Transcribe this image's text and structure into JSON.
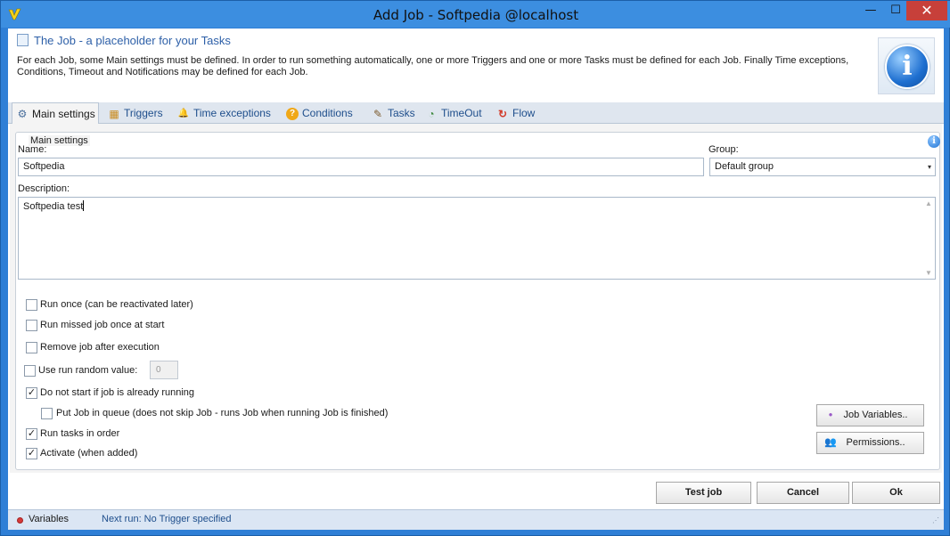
{
  "window": {
    "title": "Add Job - Softpedia @localhost",
    "minimize_glyph": "—",
    "maximize_glyph": "☐",
    "close_glyph": "✕",
    "app_icon": "vision-v-logo-icon"
  },
  "header": {
    "title": "The Job - a placeholder for your Tasks",
    "text": "For each Job, some Main settings must be defined. In order to run something automatically, one or more Triggers and one or more Tasks must be defined for each Job. Finally Time exceptions, Conditions, Timeout and Notifications may be defined for each Job.",
    "info_glyph": "i"
  },
  "tabs": [
    {
      "label": "Main settings",
      "icon": "gears-icon",
      "glyph": "⚙",
      "active": true
    },
    {
      "label": "Triggers",
      "icon": "calendar-icon",
      "glyph": "▦",
      "active": false
    },
    {
      "label": "Time exceptions",
      "icon": "bell-icon",
      "glyph": "🔔",
      "active": false
    },
    {
      "label": "Conditions",
      "icon": "question-icon",
      "glyph": "?",
      "active": false
    },
    {
      "label": "Tasks",
      "icon": "checklist-icon",
      "glyph": "✎",
      "active": false
    },
    {
      "label": "TimeOut",
      "icon": "clock-icon",
      "glyph": "◔",
      "active": false
    },
    {
      "label": "Flow",
      "icon": "flow-icon",
      "glyph": "↻",
      "active": false
    }
  ],
  "main_settings": {
    "legend": "Main settings",
    "info_glyph": "i",
    "name_label": "Name:",
    "name_value": "Softpedia",
    "group_label": "Group:",
    "group_value": "Default group",
    "dropdown_glyph": "▾",
    "description_label": "Description:",
    "description_value": "Softpedia test",
    "scroll_up": "▲",
    "scroll_down": "▼",
    "options": [
      {
        "label": "Run once (can be reactivated later)",
        "checked": false,
        "mark": ""
      },
      {
        "label": "Run missed job once at start",
        "checked": false,
        "mark": ""
      },
      {
        "label": "Remove job after execution",
        "checked": false,
        "mark": ""
      },
      {
        "label": "Use run random value:",
        "checked": false,
        "mark": ""
      },
      {
        "label": "Do not start if job is already running",
        "checked": true,
        "mark": "✓"
      },
      {
        "label": "Put Job in queue (does not skip Job - runs Job when running Job is finished)",
        "checked": false,
        "mark": ""
      },
      {
        "label": "Run tasks in order",
        "checked": true,
        "mark": "✓"
      },
      {
        "label": "Activate (when added)",
        "checked": true,
        "mark": "✓"
      }
    ],
    "random_value": "0",
    "job_variables_label": "Job Variables..",
    "permissions_label": "Permissions..",
    "job_variables_glyph": "●",
    "permissions_glyph": "👥"
  },
  "footer": {
    "test_job": "Test job",
    "cancel": "Cancel",
    "ok": "Ok"
  },
  "status": {
    "variables": "Variables",
    "next_run": "Next run: No Trigger specified",
    "grip": "⋰"
  },
  "colors": {
    "title_bar": "#3c8ee0",
    "close_button": "#c7403a",
    "link_blue": "#2e60a8",
    "status_bar": "#dbe6f4"
  }
}
